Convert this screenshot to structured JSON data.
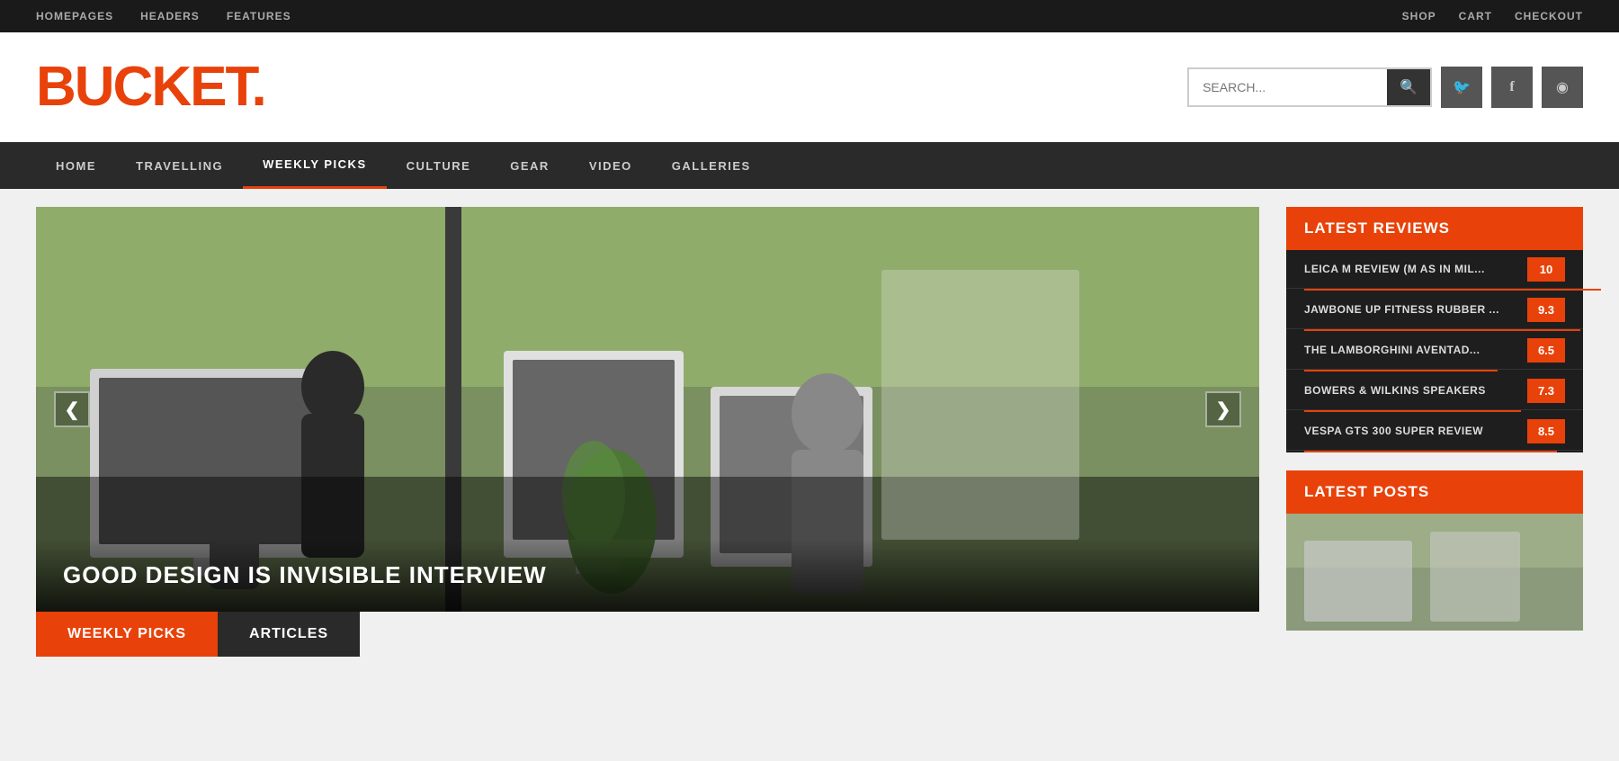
{
  "topbar": {
    "left": [
      {
        "label": "HOMEPAGES",
        "href": "#"
      },
      {
        "label": "HEADERS",
        "href": "#"
      },
      {
        "label": "FEATURES",
        "href": "#"
      }
    ],
    "right": [
      {
        "label": "SHOP",
        "href": "#"
      },
      {
        "label": "CART",
        "href": "#"
      },
      {
        "label": "CHECKOUT",
        "href": "#"
      }
    ]
  },
  "header": {
    "logo": "BUCKET.",
    "search_placeholder": "SEARCH...",
    "social": [
      {
        "icon": "🐦",
        "name": "twitter"
      },
      {
        "icon": "f",
        "name": "facebook"
      },
      {
        "icon": "◉",
        "name": "rss"
      }
    ]
  },
  "mainnav": {
    "items": [
      {
        "label": "HOME",
        "active": false
      },
      {
        "label": "TRAVELLING",
        "active": false
      },
      {
        "label": "WEEKLY PICKS",
        "active": true
      },
      {
        "label": "CULTURE",
        "active": false
      },
      {
        "label": "GEAR",
        "active": false
      },
      {
        "label": "VIDEO",
        "active": false
      },
      {
        "label": "GALLERIES",
        "active": false
      }
    ]
  },
  "slider": {
    "caption": "GOOD DESIGN IS INVISIBLE INTERVIEW",
    "prev_label": "❮",
    "next_label": "❯"
  },
  "tabs": [
    {
      "label": "WEEKLY PICKS",
      "active": true
    },
    {
      "label": "ARTICLES",
      "active": false
    }
  ],
  "sidebar": {
    "latest_reviews_title": "LATEST REVIEWS",
    "reviews": [
      {
        "text": "LEICA M REVIEW (M AS IN MIL...",
        "score": "10",
        "bar_pct": 100
      },
      {
        "text": "JAWBONE UP FITNESS RUBBER ...",
        "score": "9.3",
        "bar_pct": 93
      },
      {
        "text": "THE LAMBORGHINI AVENTAD...",
        "score": "6.5",
        "bar_pct": 65
      },
      {
        "text": "BOWERS & WILKINS SPEAKERS",
        "score": "7.3",
        "bar_pct": 73
      },
      {
        "text": "VESPA GTS 300 SUPER REVIEW",
        "score": "8.5",
        "bar_pct": 85
      }
    ],
    "latest_posts_title": "LATEST POSTS"
  }
}
